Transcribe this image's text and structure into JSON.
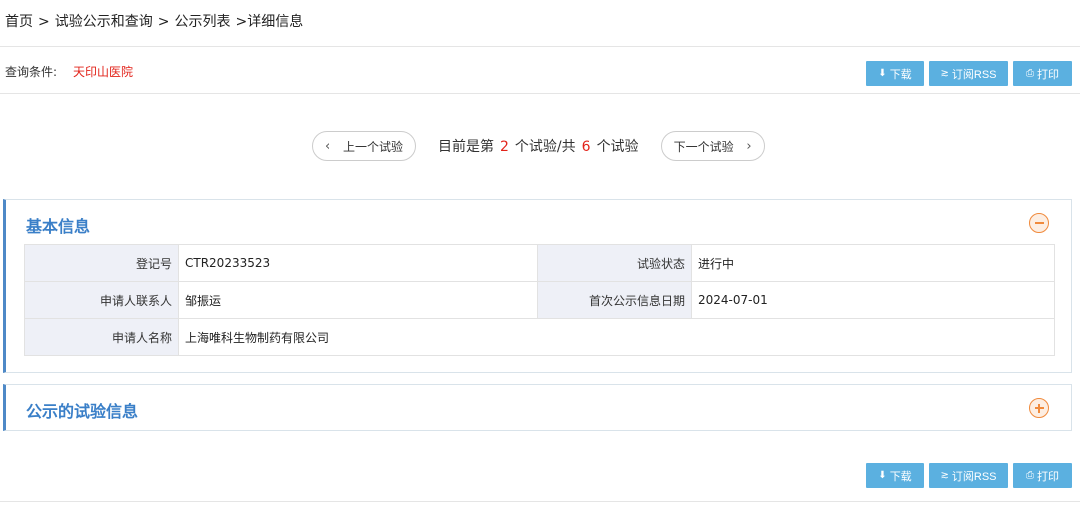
{
  "breadcrumb": {
    "home": "首页",
    "sep1": ">",
    "trials": "试验公示和查询",
    "sep2": ">",
    "list": "公示列表",
    "sep3": ">",
    "current": "详细信息"
  },
  "query": {
    "label": "查询条件:",
    "value": "天印山医院"
  },
  "toolbar": {
    "download": "下载",
    "rss": "订阅RSS",
    "print": "打印"
  },
  "pager": {
    "prev": "上一个试验",
    "next": "下一个试验",
    "prefix": "目前是第",
    "current": "2",
    "middle": "个试验/共",
    "total": "6",
    "suffix": "个试验"
  },
  "basic": {
    "title": "基本信息",
    "reg_no_label": "登记号",
    "reg_no": "CTR20233523",
    "status_label": "试验状态",
    "status": "进行中",
    "contact_label": "申请人联系人",
    "contact": "邹振运",
    "date_label": "首次公示信息日期",
    "date": "2024-07-01",
    "applicant_label": "申请人名称",
    "applicant": "上海唯科生物制药有限公司"
  },
  "trial_info": {
    "title": "公示的试验信息"
  },
  "colors": {
    "accent": "#3a7fc8",
    "button": "#5bb0e0",
    "highlight": "#e2231a",
    "toggle": "#f08a3c"
  }
}
